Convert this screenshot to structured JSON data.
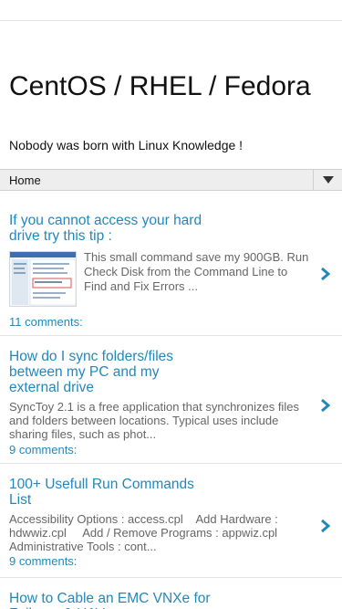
{
  "blog": {
    "title": "CentOS / RHEL / Fedora",
    "description": "Nobody was born with Linux Knowledge !"
  },
  "nav": {
    "label": "Home",
    "toggle_icon": "triangle-down-icon"
  },
  "posts": [
    {
      "title": "If you cannot access your hard drive try this tip :",
      "snippet": "This small command save my 900GB. Run Check Disk from the Command Line to Find and Fix Errors ...",
      "comments": "11 comments:",
      "has_thumbnail": true
    },
    {
      "title": "How do I sync folders/files between my PC and my external drive",
      "snippet": "SyncToy 2.1 is a free application that synchronizes files and folders between locations. Typical uses include sharing files, such as phot...",
      "comments": "9 comments:"
    },
    {
      "title": "100+ Usefull Run Commands List",
      "snippet": "Accessibility Options : access.cpl    Add Hardware : hdwwiz.cpl     Add / Remove Programs : appwiz.cpl Administrative Tools : cont...",
      "comments": "9 comments:"
    },
    {
      "title": "How to Cable an EMC VNXe for Failover & HAV..."
    }
  ],
  "colors": {
    "link": "#2288bb",
    "snippet": "#666666",
    "nav_bg": "#eeeeee"
  },
  "icons": {
    "post_arrow": "chevron-right-icon"
  }
}
